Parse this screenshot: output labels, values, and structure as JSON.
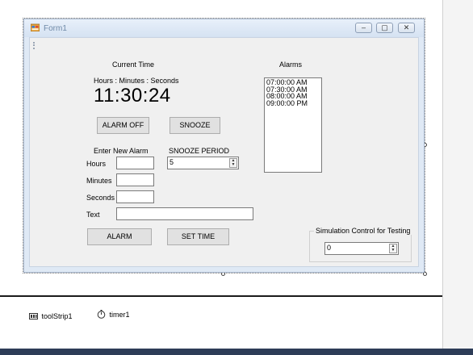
{
  "form": {
    "title": "Form1",
    "controls": {
      "minimize": "–",
      "maximize": "▢",
      "close": "✕"
    }
  },
  "current_time": {
    "label": "Current Time",
    "format_label": "Hours : Minutes : Seconds",
    "value": "11:30:24"
  },
  "buttons": {
    "alarm_off": "ALARM OFF",
    "snooze": "SNOOZE",
    "alarm": "ALARM",
    "set_time": "SET TIME"
  },
  "new_alarm": {
    "label": "Enter New Alarm",
    "hours_label": "Hours",
    "minutes_label": "Minutes",
    "seconds_label": "Seconds",
    "text_label": "Text",
    "hours_value": "",
    "minutes_value": "",
    "seconds_value": "",
    "text_value": ""
  },
  "snooze_period": {
    "label": "SNOOZE PERIOD",
    "value": "5"
  },
  "alarms": {
    "label": "Alarms",
    "items": [
      "07:00:00 AM",
      "07:30:00 AM",
      "08:00:00 AM",
      "09:00:00 PM"
    ]
  },
  "simulation": {
    "label": "Simulation Control for Testing",
    "value": "0"
  },
  "tray": {
    "items": [
      {
        "icon": "toolstrip-icon",
        "label": "toolStrip1"
      },
      {
        "icon": "timer-icon",
        "label": "timer1"
      }
    ]
  }
}
